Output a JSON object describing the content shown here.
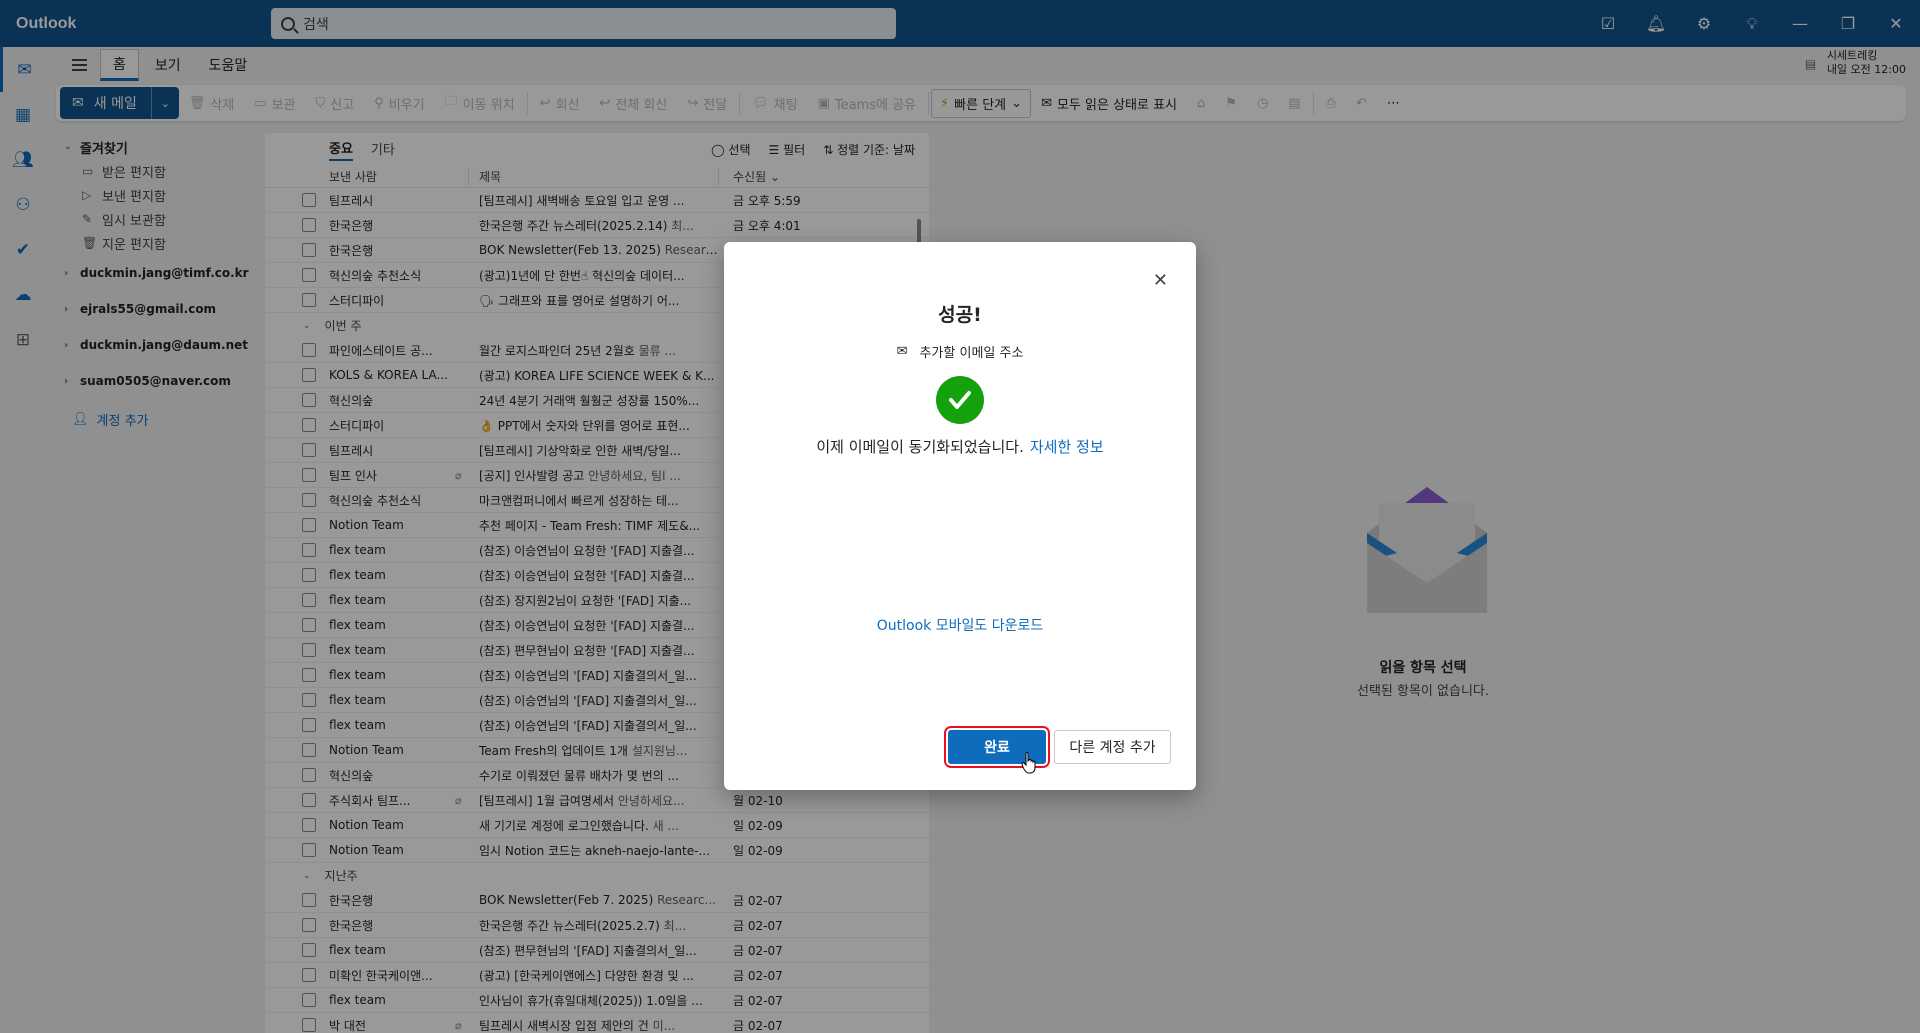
{
  "titlebar": {
    "app_name": "Outlook",
    "search_placeholder": "검색",
    "icons": [
      "my-day-icon",
      "bell-icon",
      "gear-icon",
      "lightbulb-icon",
      "minimize-icon",
      "restore-icon",
      "close-icon"
    ]
  },
  "account_info": {
    "line1": "시세트레킹",
    "line2": "내일 오전 12:00"
  },
  "ribbon": {
    "tabs": [
      "홈",
      "보기",
      "도움말"
    ],
    "new_mail": "새 메일",
    "actions": {
      "delete": "삭제",
      "archive": "보관",
      "report": "신고",
      "sweep": "비우기",
      "move": "이동 위치",
      "reply": "회신",
      "reply_all": "전체 회신",
      "forward": "전달",
      "chat": "채팅",
      "teams": "Teams에 공유",
      "quick_steps": "빠른 단계",
      "mark_all_read": "모두 읽은 상태로 표시"
    }
  },
  "folders": {
    "favorites": "즐겨찾기",
    "items": [
      "받은 편지함",
      "보낸 편지함",
      "임시 보관함",
      "지운 편지함"
    ],
    "accounts": [
      "duckmin.jang@timf.co.kr",
      "ejrals55@gmail.com",
      "duckmin.jang@daum.net",
      "suam0505@naver.com"
    ],
    "add_account": "계정 추가"
  },
  "message_list": {
    "tabs": [
      "중요",
      "기타"
    ],
    "tools": {
      "select": "선택",
      "filter": "필터",
      "sort": "정렬 기준: 날짜"
    },
    "columns": {
      "from": "보낸 사람",
      "subject": "제목",
      "received": "수신됨"
    },
    "rows_top": [
      {
        "sender": "팀프레시",
        "subject": "[팀프레시] 새벽배송 토요일 입고 운영 ...",
        "date": "금 오후 5:59"
      },
      {
        "sender": "한국은행",
        "subject": "한국은행 주간 뉴스레터(2025.2.14)",
        "preview": "최...",
        "date": "금 오후 4:01"
      },
      {
        "sender": "한국은행",
        "subject": "BOK Newsletter(Feb 13. 2025)",
        "preview": "Researc...",
        "date": ""
      },
      {
        "sender": "혁신의숲 추천소식",
        "subject": "(광고)1년에 단 한번☝ 혁신의숲 데이터...",
        "date": ""
      },
      {
        "sender": "스터디파이",
        "subject": "🗣 그래프와 표를 영어로 설명하기 어...",
        "date": ""
      }
    ],
    "group_this_week": "이번 주",
    "rows_week": [
      {
        "sender": "파인에스테이트 공...",
        "subject": "월간 로지스파인더 25년 2월호",
        "preview": "물류 ...",
        "date": ""
      },
      {
        "sender": "KOLS & KOREA LA...",
        "subject": "(광고) KOREA LIFE SCIENCE WEEK & K...",
        "date": ""
      },
      {
        "sender": "혁신의숲",
        "subject": "24년 4분기 거래액 훨훨군 성장률 150%...",
        "date": ""
      },
      {
        "sender": "스터디파이",
        "subject": "👌 PPT에서 숫자와 단위를 영어로 표현...",
        "date": ""
      },
      {
        "sender": "팀프레시",
        "subject": "[팀프레시] 기상악화로 인한 새벽/당일...",
        "date": ""
      },
      {
        "sender": "팀프 인사",
        "subject": "[공지] 인사발령 공고",
        "preview": "안녕하세요, 팀I ...",
        "date": "",
        "clip": true
      },
      {
        "sender": "혁신의숲 추천소식",
        "subject": "마크앤컴퍼니에서 빠르게 성장하는 테...",
        "date": ""
      },
      {
        "sender": "Notion Team",
        "subject": "추천 페이지 - Team Fresh: TIMF 제도&...",
        "date": ""
      },
      {
        "sender": "flex team",
        "subject": "(참조) 이승연님이 요청한 '[FAD] 지출결...",
        "date": ""
      },
      {
        "sender": "flex team",
        "subject": "(참조) 이승연님이 요청한 '[FAD] 지출결...",
        "date": ""
      },
      {
        "sender": "flex team",
        "subject": "(참조) 장지원2님이 요청한 '[FAD] 지출...",
        "date": ""
      },
      {
        "sender": "flex team",
        "subject": "(참조) 이승연님이 요청한 '[FAD] 지출결...",
        "date": ""
      },
      {
        "sender": "flex team",
        "subject": "(참조) 편무현님이 요청한 '[FAD] 지출결...",
        "date": ""
      },
      {
        "sender": "flex team",
        "subject": "(참조) 이승연님의 '[FAD] 지출결의서_일...",
        "date": ""
      },
      {
        "sender": "flex team",
        "subject": "(참조) 이승연님의 '[FAD] 지출결의서_일...",
        "date": ""
      },
      {
        "sender": "flex team",
        "subject": "(참조) 이승연님의 '[FAD] 지출결의서_일...",
        "date": ""
      },
      {
        "sender": "Notion Team",
        "subject": "Team Fresh의 업데이트 1개",
        "preview": "설지원님...",
        "date": ""
      },
      {
        "sender": "혁신의숲",
        "subject": "수기로 이뤄졌던 물류 배차가 몇 번의 ...",
        "date": ""
      },
      {
        "sender": "주식회사 팀프...",
        "subject": "[팀프레시] 1월 급여명세서",
        "preview": "안녕하세요...",
        "date": "월 02-10",
        "clip": true
      },
      {
        "sender": "Notion Team",
        "subject": "새 기기로 계정에 로그인했습니다.",
        "preview": "새 ...",
        "date": "일 02-09"
      },
      {
        "sender": "Notion Team",
        "subject": "임시 Notion 코드는 akneh-naejo-lante-...",
        "date": "일 02-09"
      }
    ],
    "group_last_week": "지난주",
    "rows_last": [
      {
        "sender": "한국은행",
        "subject": "BOK Newsletter(Feb 7. 2025)",
        "preview": "Researc...",
        "date": "금 02-07"
      },
      {
        "sender": "한국은행",
        "subject": "한국은행 주간 뉴스레터(2025.2.7)",
        "preview": "최...",
        "date": "금 02-07"
      },
      {
        "sender": "flex team",
        "subject": "(참조) 편무현님의 '[FAD] 지출결의서_일...",
        "date": "금 02-07"
      },
      {
        "sender": "미확인 한국케이앤...",
        "subject": "(광고) [한국케이앤에스] 다양한 환경 및 ...",
        "date": "금 02-07"
      },
      {
        "sender": "flex team",
        "subject": "인사님이 휴가(휴일대체(2025)) 1.0일을 ...",
        "date": "금 02-07"
      },
      {
        "sender": "박 대전",
        "subject": "팀프레시 새벽시장 입점 제안의 건",
        "preview": "미...",
        "date": "금 02-07",
        "clip": true
      }
    ]
  },
  "reading_pane": {
    "title": "읽을 항목 선택",
    "subtitle": "선택된 항목이 없습니다."
  },
  "dialog": {
    "title": "성공!",
    "email_label": "추가할 이메일 주소",
    "message": "이제 이메일이 동기화되었습니다.",
    "more_info": "자세한 정보",
    "mobile_link": "Outlook 모바일도 다운로드",
    "done_button": "완료",
    "add_another_button": "다른 계정 추가"
  }
}
